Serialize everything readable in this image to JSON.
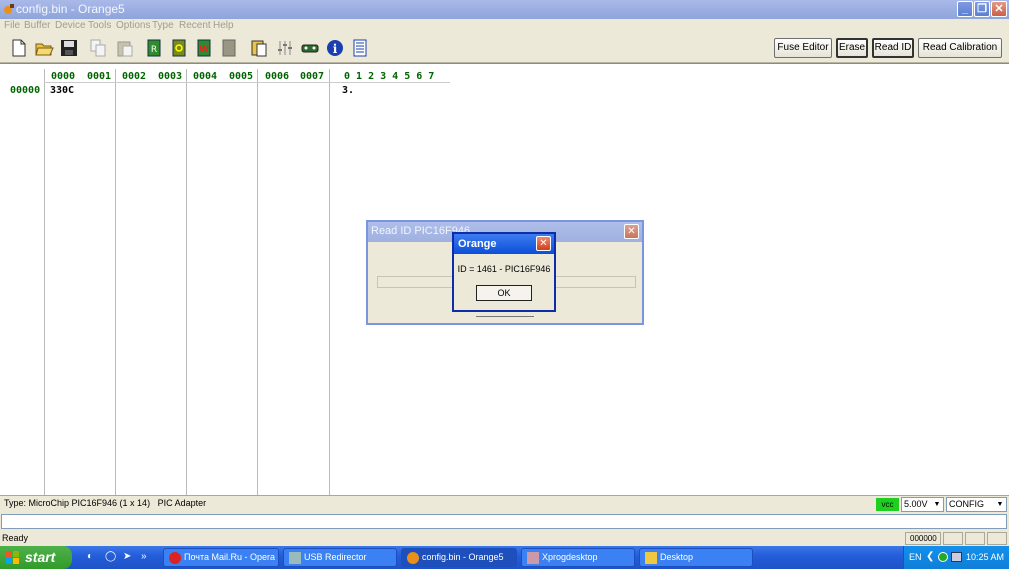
{
  "window": {
    "title": "config.bin - Orange5"
  },
  "menu": [
    "File",
    "Buffer",
    "Device",
    "Tools",
    "Options",
    "Type",
    "Recent",
    "Help"
  ],
  "toolbar": {
    "icons": [
      "new-file-icon",
      "open-folder-icon",
      "save-icon",
      "copy-icon",
      "paste-icon",
      "read-chip-icon",
      "verify-chip-icon",
      "write-chip-icon",
      "erase-chip-icon",
      "clipboard-icon",
      "settings-sliders-icon",
      "programmer-icon",
      "info-icon",
      "memory-map-icon"
    ],
    "buttons": {
      "fuse_editor": "Fuse Editor",
      "erase": "Erase",
      "read_id": "Read ID",
      "read_calibration": "Read Calibration"
    }
  },
  "hex": {
    "word_headers": [
      "0000",
      "0001",
      "0002",
      "0003",
      "0004",
      "0005",
      "0006",
      "0007"
    ],
    "ascii_headers": "0 1 2 3 4 5 6 7",
    "rows": [
      {
        "address": "00000",
        "word0": "330C",
        "ascii": "3."
      }
    ]
  },
  "status": {
    "type_text": "Type: MicroChip PIC16F946 (1 x 14)",
    "adapter": "PIC Adapter",
    "vcc_label": "vcc",
    "voltage": "5.00V",
    "region": "CONFIG",
    "ready": "Ready",
    "address": "000000"
  },
  "dialog_read_id": {
    "title": "Read ID PIC16F946"
  },
  "dialog_message": {
    "title": "Orange",
    "message": "ID = 1461 - PIC16F946",
    "ok": "OK"
  },
  "taskbar": {
    "start": "start",
    "tasks": [
      "Почта Mail.Ru - Opera",
      "USB Redirector",
      "config.bin - Orange5",
      "Xprogdesktop",
      "Desktop"
    ],
    "language": "EN",
    "time": "10:25 AM"
  },
  "colors": {
    "hex_header": "#006400",
    "vcc_indicator": "#1fcf1f",
    "taskbar": "#245edb"
  }
}
